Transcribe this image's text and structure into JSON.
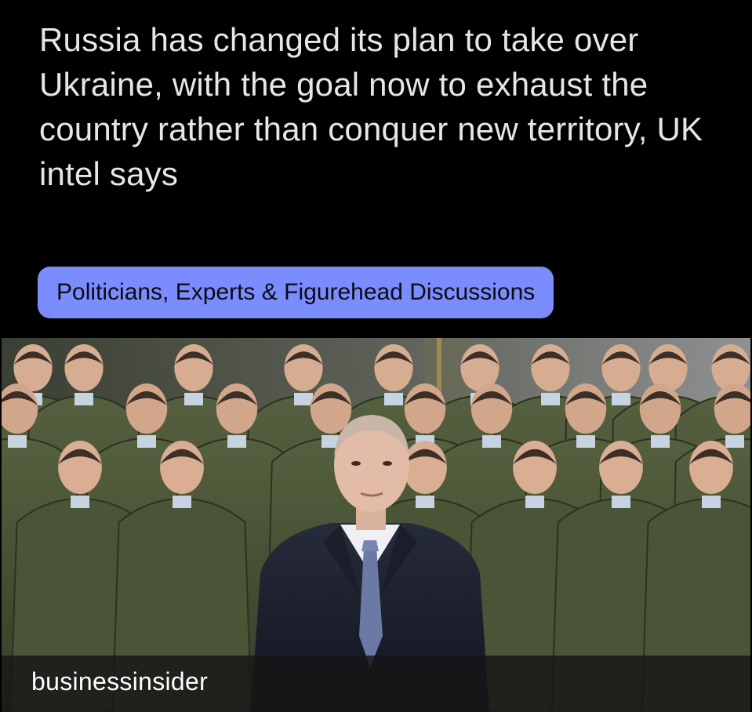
{
  "post": {
    "headline": "Russia has changed its plan to take over Ukraine, with the goal now to exhaust the country rather than conquer new territory, UK intel says",
    "flair": "Politicians, Experts & Figurehead Discussions",
    "source": "businessinsider"
  },
  "colors": {
    "background": "#000000",
    "headline_text": "#e6e6e6",
    "flair_background": "#7b8cff",
    "flair_text": "#0b0b12",
    "source_bar": "#161616",
    "uniform_green": "#4a5538",
    "suit_navy": "#1b2030"
  },
  "media": {
    "kind": "news-photo",
    "content": "group photo of a man in a dark suit and blue tie standing in front of uniformed soldiers"
  }
}
